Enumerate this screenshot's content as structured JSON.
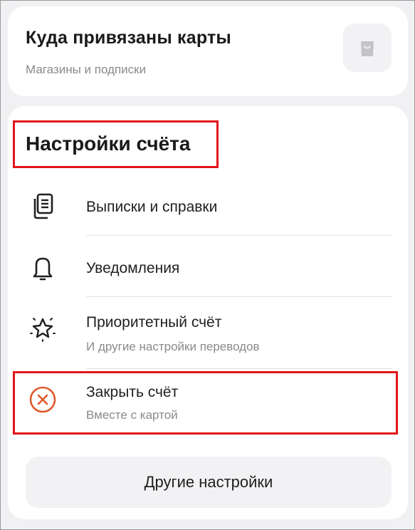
{
  "linked_cards": {
    "title": "Куда привязаны карты",
    "subtitle": "Магазины и подписки",
    "icon": "shopping-bag-icon"
  },
  "account_settings": {
    "title": "Настройки счёта",
    "items": [
      {
        "label": "Выписки и справки",
        "subtitle": "",
        "icon": "documents-icon"
      },
      {
        "label": "Уведомления",
        "subtitle": "",
        "icon": "bell-icon"
      },
      {
        "label": "Приоритетный счёт",
        "subtitle": "И другие настройки переводов",
        "icon": "star-icon"
      },
      {
        "label": "Закрыть счёт",
        "subtitle": "Вместе с картой",
        "icon": "close-circle-icon"
      }
    ],
    "other_button": "Другие настройки"
  },
  "colors": {
    "highlight": "#e3141b",
    "close_accent": "#e0592a",
    "background": "#f1f1f3"
  }
}
